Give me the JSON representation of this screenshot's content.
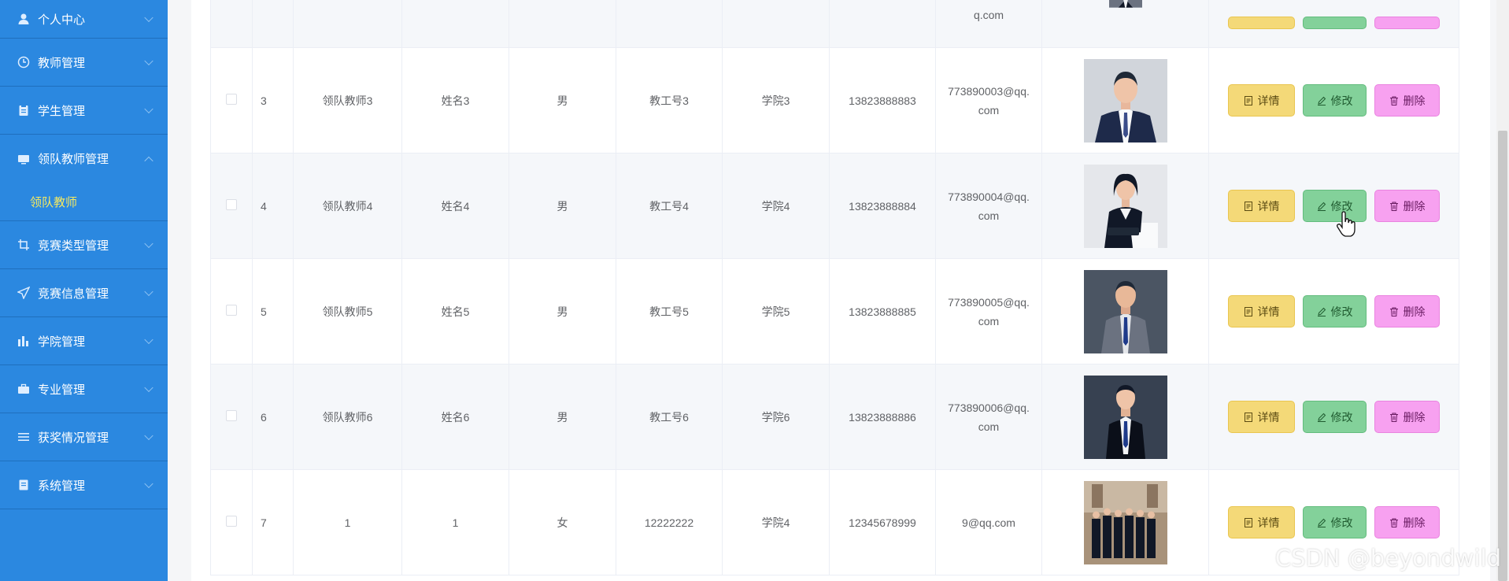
{
  "sidebar": {
    "items": [
      {
        "label": "个人中心",
        "icon": "user-icon"
      },
      {
        "label": "教师管理",
        "icon": "clock-icon"
      },
      {
        "label": "学生管理",
        "icon": "clipboard-icon"
      },
      {
        "label": "领队教师管理",
        "icon": "monitor-icon",
        "open": true
      },
      {
        "label": "竞赛类型管理",
        "icon": "crop-icon"
      },
      {
        "label": "竞赛信息管理",
        "icon": "send-icon"
      },
      {
        "label": "学院管理",
        "icon": "chart-icon"
      },
      {
        "label": "专业管理",
        "icon": "briefcase-icon"
      },
      {
        "label": "获奖情况管理",
        "icon": "list-icon"
      },
      {
        "label": "系统管理",
        "icon": "document-icon"
      }
    ],
    "submenu": {
      "label": "领队教师"
    }
  },
  "table": {
    "top_row": {
      "email_tail": "q.com"
    },
    "rows": [
      {
        "idx": "3",
        "account": "领队教师3",
        "name": "姓名3",
        "gender": "男",
        "job_no": "教工号3",
        "college": "学院3",
        "phone": "13823888883",
        "email": "773890003@qq.com",
        "photo": "man-dark-suit"
      },
      {
        "idx": "4",
        "account": "领队教师4",
        "name": "姓名4",
        "gender": "男",
        "job_no": "教工号4",
        "college": "学院4",
        "phone": "13823888884",
        "email": "773890004@qq.com",
        "photo": "woman-suit"
      },
      {
        "idx": "5",
        "account": "领队教师5",
        "name": "姓名5",
        "gender": "男",
        "job_no": "教工号5",
        "college": "学院5",
        "phone": "13823888885",
        "email": "773890005@qq.com",
        "photo": "man-grey-suit"
      },
      {
        "idx": "6",
        "account": "领队教师6",
        "name": "姓名6",
        "gender": "男",
        "job_no": "教工号6",
        "college": "学院6",
        "phone": "13823888886",
        "email": "773890006@qq.com",
        "photo": "man-black-suit"
      },
      {
        "idx": "7",
        "account": "1",
        "name": "1",
        "gender": "女",
        "job_no": "12222222",
        "college": "学院4",
        "phone": "12345678999",
        "email": "9@qq.com",
        "photo": "group-photo"
      }
    ],
    "actions": {
      "detail": "详情",
      "edit": "修改",
      "delete": "删除"
    }
  },
  "watermark": "CSDN @beyondwild",
  "colors": {
    "sidebar": "#2b88e0",
    "submenu_active": "#f5e960",
    "detail": "#f4d978",
    "edit": "#83d19a",
    "delete": "#f7a1f0"
  }
}
